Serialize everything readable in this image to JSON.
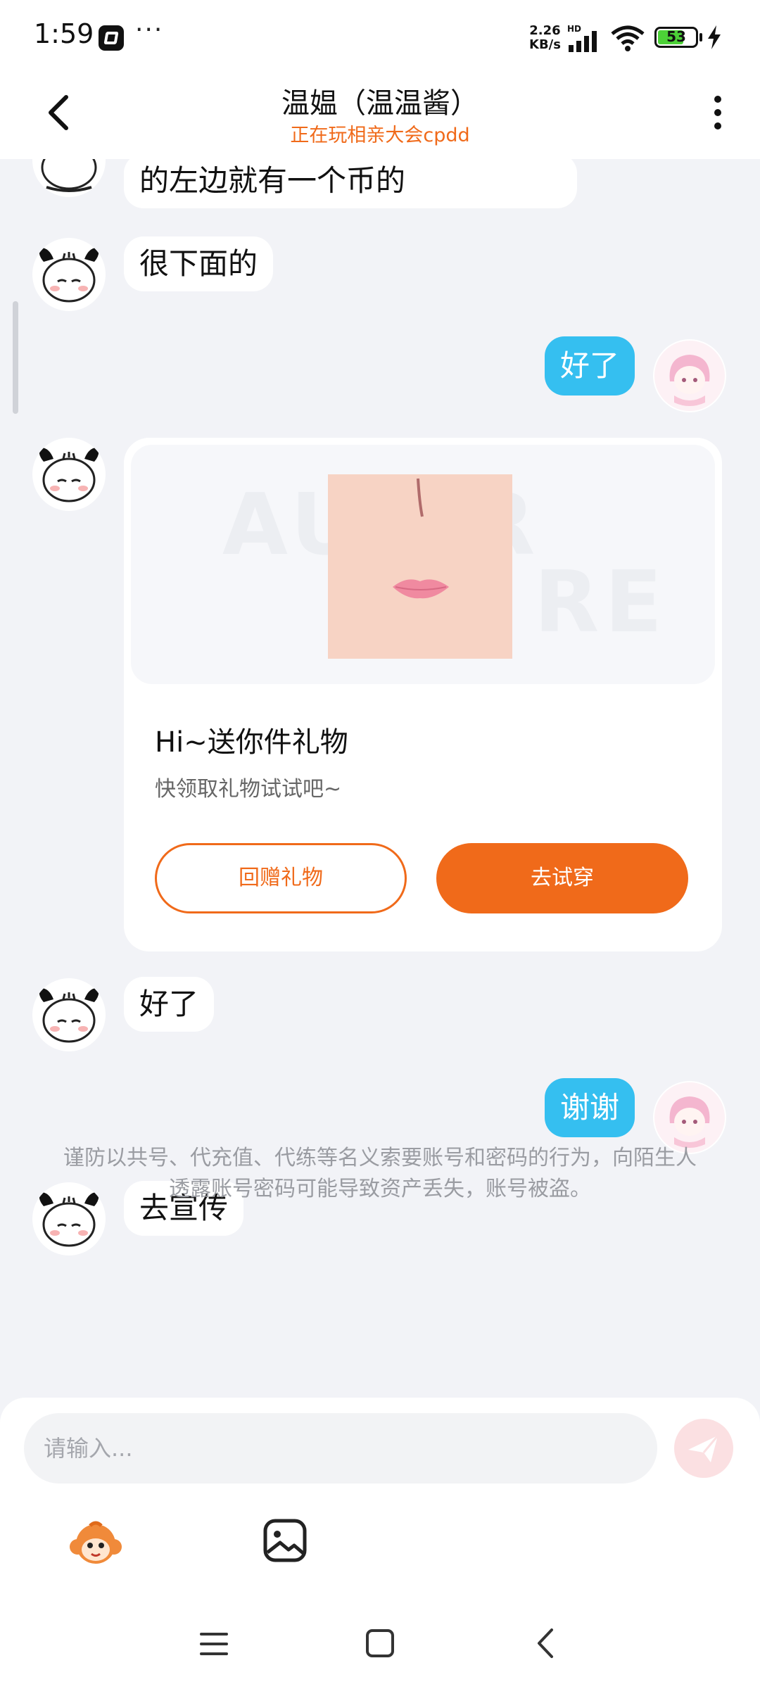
{
  "status_bar": {
    "time": "1:59",
    "network_speed_value": "2.26",
    "network_speed_unit": "KB/s",
    "hd_label": "HD",
    "battery_level": "53"
  },
  "header": {
    "title": "温媪（温温酱）",
    "subtitle": "正在玩相亲大会cpdd"
  },
  "messages": {
    "m1": "的左边就有一个币的",
    "m2": "很下面的",
    "m3": "好了",
    "m4": "好了",
    "m5": "谢谢",
    "m6": "去宣传"
  },
  "gift_card": {
    "title": "Hi~送你件礼物",
    "subtitle": "快领取礼物试试吧~",
    "return_gift_label": "回赠礼物",
    "try_on_label": "去试穿"
  },
  "notice": "谨防以共号、代充值、代练等名义索要账号和密码的行为，向陌生人透露账号密码可能导致资产丢失，账号被盗。",
  "input": {
    "placeholder": "请输入..."
  },
  "colors": {
    "accent": "#f06a1a",
    "outgoing_bubble": "#35bff0",
    "background": "#f2f3f7"
  },
  "icons": [
    "back-arrow-icon",
    "more-vertical-icon",
    "send-icon",
    "emoji-monkey-icon",
    "image-icon",
    "menu-icon",
    "home-icon",
    "back-icon"
  ]
}
